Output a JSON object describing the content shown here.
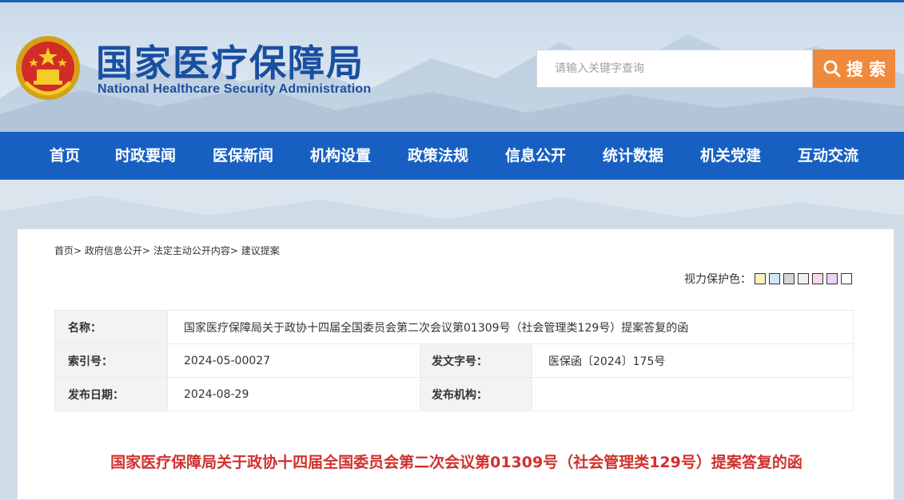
{
  "header": {
    "title_cn": "国家医疗保障局",
    "title_en": "National Healthcare Security Administration",
    "emblem_icon": "national-emblem-icon"
  },
  "search": {
    "placeholder": "请输入关键字查询",
    "button_label": "搜 索"
  },
  "nav": {
    "items": [
      "首页",
      "时政要闻",
      "医保新闻",
      "机构设置",
      "政策法规",
      "信息公开",
      "统计数据",
      "机关党建",
      "互动交流"
    ]
  },
  "breadcrumb": {
    "items": [
      "首页",
      "政府信息公开",
      "法定主动公开内容",
      "建议提案"
    ],
    "separator": ">"
  },
  "eye_protect": {
    "label": "视力保护色：",
    "colors": [
      "#f9f1c0",
      "#cfe8f5",
      "#d4d4d4",
      "#f0f0f0",
      "#f8d8e8",
      "#e8d4f4",
      "#ffffff"
    ]
  },
  "meta": {
    "name_label": "名称：",
    "name_value": "国家医疗保障局关于政协十四届全国委员会第二次会议第01309号（社会管理类129号）提案答复的函",
    "index_label": "索引号：",
    "index_value": "2024-05-00027",
    "docno_label": "发文字号：",
    "docno_value": "医保函〔2024〕175号",
    "date_label": "发布日期：",
    "date_value": "2024-08-29",
    "org_label": "发布机构：",
    "org_value": ""
  },
  "doc_title": "国家医疗保障局关于政协十四届全国委员会第二次会议第01309号（社会管理类129号）提案答复的函",
  "colors": {
    "nav_bg": "#1760c2",
    "search_btn": "#ef8a3c",
    "title_blue": "#1a4fa0",
    "doc_title_red": "#d0312d"
  }
}
